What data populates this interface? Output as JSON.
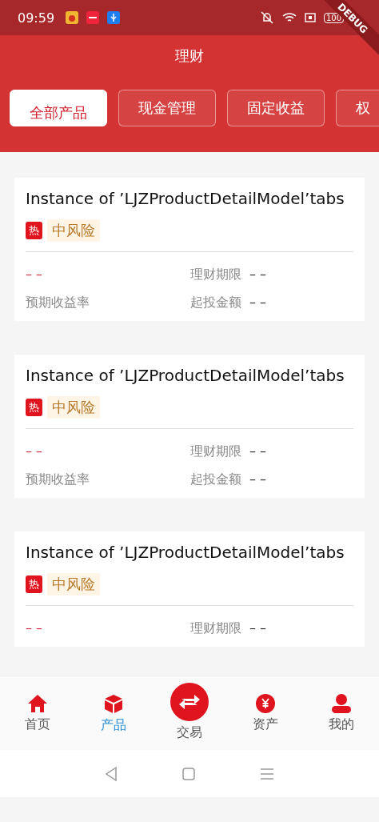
{
  "status_bar": {
    "time": "09:59",
    "battery": "100"
  },
  "debug_banner": "DEBUG",
  "header": {
    "title": "理财"
  },
  "tabs": [
    {
      "label": "全部产品",
      "selected": true
    },
    {
      "label": "现金管理",
      "selected": false
    },
    {
      "label": "固定收益",
      "selected": false
    },
    {
      "label": "权",
      "selected": false
    }
  ],
  "products": [
    {
      "title": "Instance of ’LJZProductDetailModel’tabs",
      "tags": [
        {
          "text": "热",
          "kind": "hot"
        },
        {
          "text": "中风险",
          "kind": "risk"
        }
      ],
      "yield_value": "– –",
      "yield_label": "预期收益率",
      "term_label": "理财期限",
      "term_value": "– –",
      "amount_label": "起投金额",
      "amount_value": "– –"
    },
    {
      "title": "Instance of ’LJZProductDetailModel’tabs",
      "tags": [
        {
          "text": "热",
          "kind": "hot"
        },
        {
          "text": "中风险",
          "kind": "risk"
        }
      ],
      "yield_value": "– –",
      "yield_label": "预期收益率",
      "term_label": "理财期限",
      "term_value": "– –",
      "amount_label": "起投金额",
      "amount_value": "– –"
    },
    {
      "title": "Instance of ’LJZProductDetailModel’tabs",
      "tags": [
        {
          "text": "热",
          "kind": "hot"
        },
        {
          "text": "中风险",
          "kind": "risk"
        }
      ],
      "yield_value": "– –",
      "term_label": "理财期限",
      "term_value": "– –"
    }
  ],
  "bottom_nav": [
    {
      "label": "首页",
      "kind": "home",
      "selected": false
    },
    {
      "label": "产品",
      "kind": "product",
      "selected": true
    },
    {
      "label": "交易",
      "kind": "trade",
      "selected": false
    },
    {
      "label": "资产",
      "kind": "assets",
      "selected": false
    },
    {
      "label": "我的",
      "kind": "me",
      "selected": false
    }
  ]
}
